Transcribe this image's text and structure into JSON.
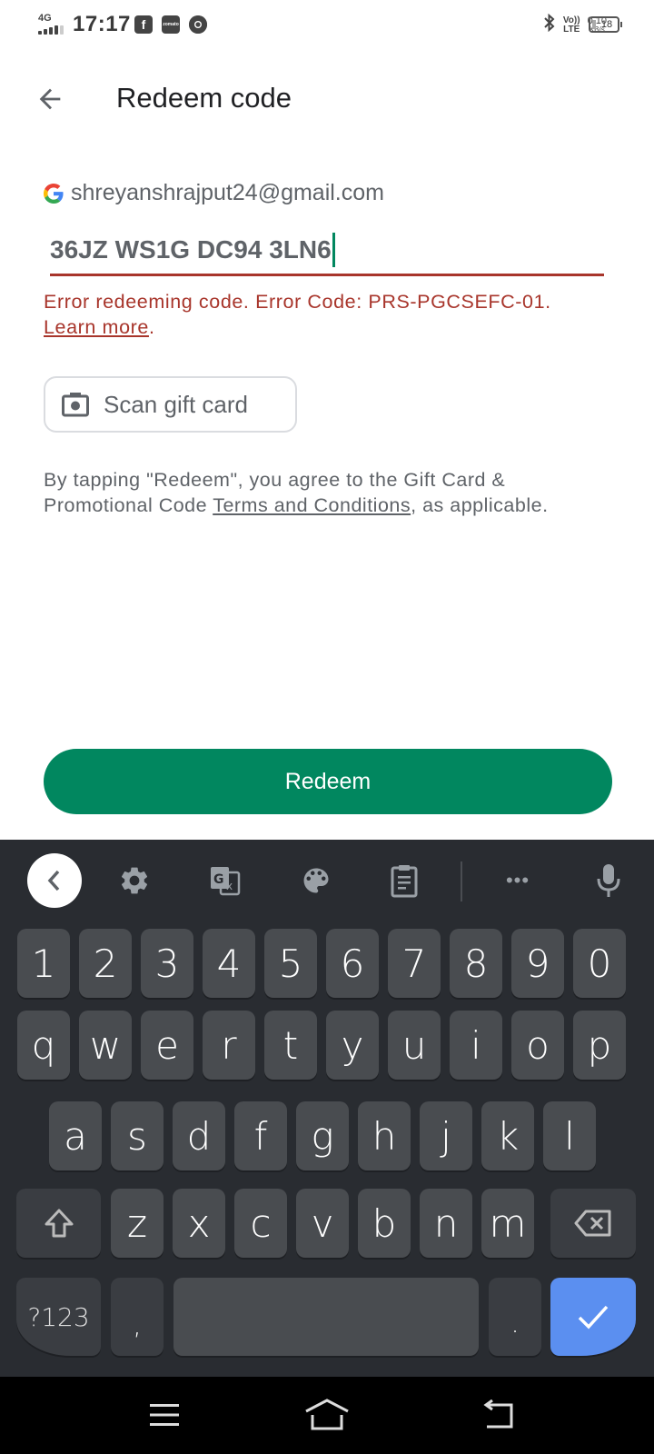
{
  "status_bar": {
    "network": "4G",
    "time": "17:17",
    "notification_apps": [
      "facebook",
      "zomato",
      "chrome"
    ],
    "volte_top": "Vo))",
    "volte_bottom": "LTE",
    "speed_value": "0.10",
    "speed_unit": "KB/s",
    "battery": "18"
  },
  "app_bar": {
    "back_icon": "arrow-back-icon",
    "title": "Redeem code"
  },
  "account": {
    "icon": "google-logo",
    "email": "shreyanshrajput24@gmail.com"
  },
  "code_input": {
    "value": "36JZ WS1G DC94 3LN6"
  },
  "error": {
    "message": "Error redeeming code. Error Code: PRS-PGCSEFC-01.",
    "link": "Learn more",
    "suffix": "."
  },
  "scan_button": {
    "icon": "camera-icon",
    "label": "Scan gift card"
  },
  "terms": {
    "prefix": "By tapping \"Redeem\", you agree to the Gift Card & Promotional Code ",
    "link": "Terms and Conditions",
    "suffix": ", as applicable."
  },
  "redeem_button": {
    "label": "Redeem"
  },
  "colors": {
    "primary_green": "#01875f",
    "error_red": "#a8352b",
    "enter_key_blue": "#5b8ff0",
    "keyboard_bg": "#292c31",
    "key_bg": "#494c50"
  },
  "keyboard": {
    "toolbar": [
      "collapse",
      "settings",
      "translate",
      "theme",
      "clipboard",
      "more",
      "voice"
    ],
    "more_label": "•••",
    "rows": [
      [
        "1",
        "2",
        "3",
        "4",
        "5",
        "6",
        "7",
        "8",
        "9",
        "0"
      ],
      [
        "q",
        "w",
        "e",
        "r",
        "t",
        "y",
        "u",
        "i",
        "o",
        "p"
      ],
      [
        "a",
        "s",
        "d",
        "f",
        "g",
        "h",
        "j",
        "k",
        "l"
      ],
      [
        "z",
        "x",
        "c",
        "v",
        "b",
        "n",
        "m"
      ]
    ],
    "symbols_label": "?123",
    "comma": ",",
    "period": "."
  },
  "nav_bar": {
    "buttons": [
      "menu",
      "home",
      "back"
    ]
  }
}
